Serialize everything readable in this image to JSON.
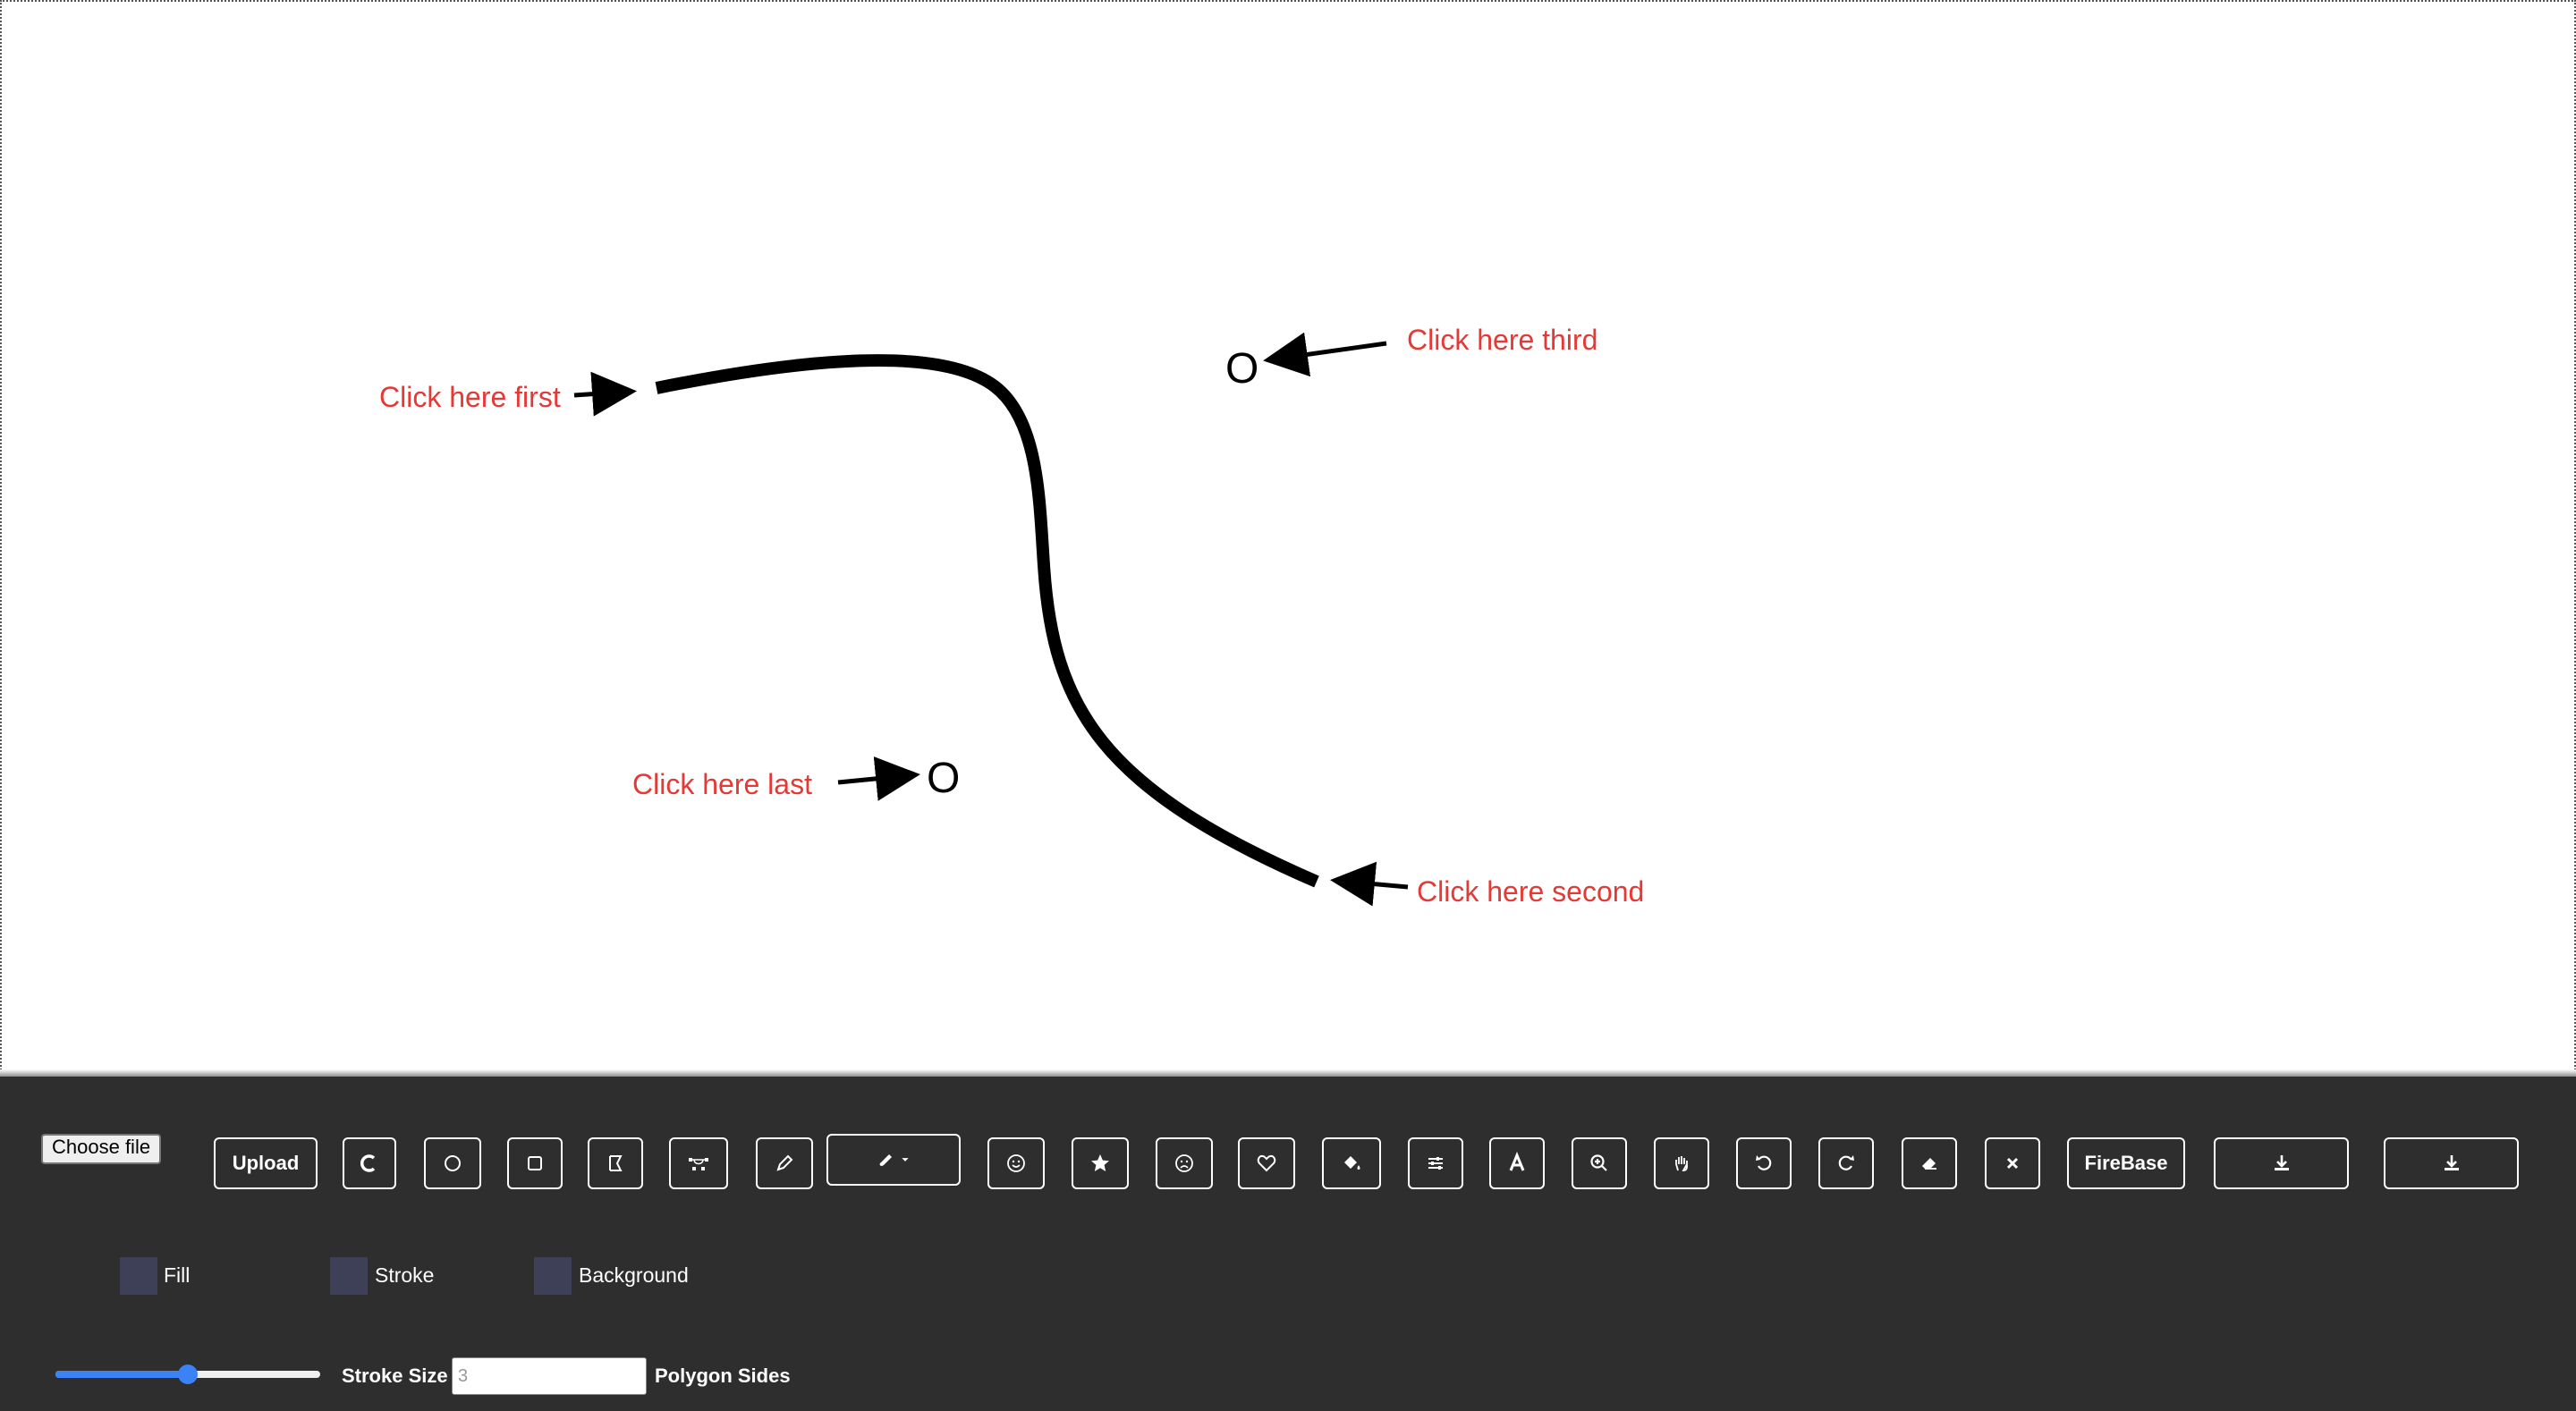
{
  "annotations": {
    "first": "Click here first",
    "second": "Click here second",
    "third": "Click here third",
    "last": "Click here last"
  },
  "canvas_markers": {
    "circle_glyph": "O"
  },
  "toolbar": {
    "choose_file_label": "Choose file",
    "upload_label": "Upload",
    "firebase_label": "FireBase",
    "tools": [
      "curve-tool",
      "circle-tool",
      "rectangle-tool",
      "polygon-tool",
      "bezier-tool",
      "pencil-tool",
      "brush-dropdown",
      "emoji-tool",
      "star-tool",
      "sad-face-tool",
      "heart-tool",
      "fill-bucket-tool",
      "settings-tool",
      "text-tool",
      "zoom-tool",
      "pan-tool",
      "undo",
      "redo",
      "eraser",
      "clear"
    ]
  },
  "colors": {
    "fill_label": "Fill",
    "stroke_label": "Stroke",
    "background_label": "Background",
    "swatch_color": "#3d4057",
    "annotation_color": "#e53935",
    "slider_color": "#3b82f6"
  },
  "stroke": {
    "size_label": "Stroke Size",
    "size_value": 0.5
  },
  "polygon": {
    "sides_label": "Polygon Sides",
    "sides_placeholder": "3"
  }
}
